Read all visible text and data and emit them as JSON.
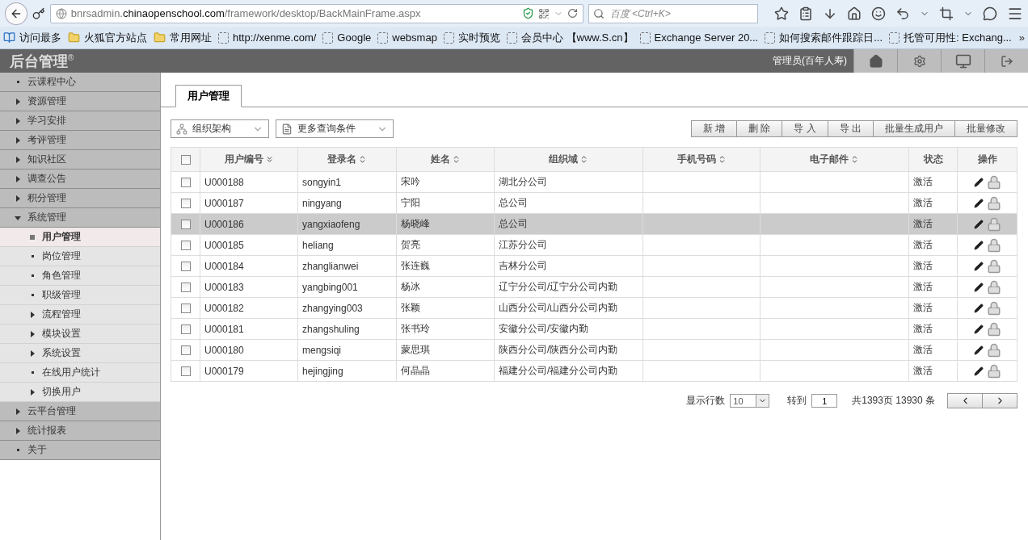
{
  "browser": {
    "url_prefix": "bnrsadmin.",
    "url_domain": "chinaopenschool.com",
    "url_path": "/framework/desktop/BackMainFrame.aspx",
    "search_placeholder": "百度 <Ctrl+K>",
    "bookmarks": [
      {
        "label": "访问最多",
        "kind": "smart"
      },
      {
        "label": "火狐官方站点",
        "kind": "folder"
      },
      {
        "label": "常用网址",
        "kind": "folder"
      },
      {
        "label": "http://xenme.com/",
        "kind": "page"
      },
      {
        "label": "Google",
        "kind": "page"
      },
      {
        "label": "websmap",
        "kind": "page"
      },
      {
        "label": "实时预览",
        "kind": "page"
      },
      {
        "label": "会员中心 【www.S.cn】",
        "kind": "page"
      },
      {
        "label": "Exchange Server 20...",
        "kind": "page"
      },
      {
        "label": "如何搜索邮件跟踪日...",
        "kind": "page"
      },
      {
        "label": "托管可用性: Exchang...",
        "kind": "page"
      }
    ],
    "overflow": "»"
  },
  "app": {
    "logo": "后台管理",
    "logo_mark": "®",
    "user": "管理员(百年人寿)"
  },
  "sidebar": {
    "items": [
      {
        "label": "云课程中心",
        "kind": "leaf"
      },
      {
        "label": "资源管理",
        "kind": "folder",
        "expanded": false
      },
      {
        "label": "学习安排",
        "kind": "folder",
        "expanded": false
      },
      {
        "label": "考评管理",
        "kind": "folder",
        "expanded": false
      },
      {
        "label": "知识社区",
        "kind": "folder",
        "expanded": false
      },
      {
        "label": "调查公告",
        "kind": "folder",
        "expanded": false
      },
      {
        "label": "积分管理",
        "kind": "folder",
        "expanded": false
      },
      {
        "label": "系统管理",
        "kind": "folder",
        "expanded": true,
        "children": [
          {
            "label": "用户管理",
            "kind": "leaf",
            "selected": true
          },
          {
            "label": "岗位管理",
            "kind": "leaf",
            "selected": false
          },
          {
            "label": "角色管理",
            "kind": "leaf",
            "selected": false
          },
          {
            "label": "职级管理",
            "kind": "leaf",
            "selected": false
          },
          {
            "label": "流程管理",
            "kind": "folder",
            "expanded": false,
            "selected": false
          },
          {
            "label": "模块设置",
            "kind": "folder",
            "expanded": false,
            "selected": false
          },
          {
            "label": "系统设置",
            "kind": "folder",
            "expanded": false,
            "selected": false
          },
          {
            "label": "在线用户统计",
            "kind": "leaf",
            "selected": false
          },
          {
            "label": "切换用户",
            "kind": "folder",
            "expanded": false,
            "selected": false
          }
        ]
      },
      {
        "label": "云平台管理",
        "kind": "folder",
        "expanded": false
      },
      {
        "label": "统计报表",
        "kind": "folder",
        "expanded": false
      },
      {
        "label": "关于",
        "kind": "leaf"
      }
    ]
  },
  "tabs": [
    {
      "label": "用户管理",
      "selected": true
    }
  ],
  "filters": [
    {
      "label": "组织架构",
      "kind": "tree"
    },
    {
      "label": "更多查询条件",
      "kind": "list"
    }
  ],
  "actions": [
    "新 增",
    "删 除",
    "导 入",
    "导 出",
    "批量生成用户",
    "批量修改"
  ],
  "table": {
    "all_checked": false,
    "columns": [
      {
        "label": "用户编号",
        "kind": "sorted"
      },
      {
        "label": "登录名",
        "kind": "sortable"
      },
      {
        "label": "姓名",
        "kind": "sortable"
      },
      {
        "label": "组织域",
        "kind": "sortable"
      },
      {
        "label": "手机号码",
        "kind": "sortable"
      },
      {
        "label": "电子邮件",
        "kind": "sortable"
      },
      {
        "label": "状态",
        "kind": "plain"
      },
      {
        "label": "操作",
        "kind": "plain"
      }
    ],
    "rows": [
      {
        "id": "U000188",
        "login": "songyin1",
        "name": "宋吟",
        "org": "湖北分公司",
        "status": "激活",
        "checked": false,
        "selected": false
      },
      {
        "id": "U000187",
        "login": "ningyang",
        "name": "宁阳",
        "org": "总公司",
        "status": "激活",
        "checked": false,
        "selected": false
      },
      {
        "id": "U000186",
        "login": "yangxiaofeng",
        "name": "杨晓峰",
        "org": "总公司",
        "status": "激活",
        "checked": false,
        "selected": true
      },
      {
        "id": "U000185",
        "login": "heliang",
        "name": "贺亮",
        "org": "江苏分公司",
        "status": "激活",
        "checked": false,
        "selected": false
      },
      {
        "id": "U000184",
        "login": "zhanglianwei",
        "name": "张连巍",
        "org": "吉林分公司",
        "status": "激活",
        "checked": false,
        "selected": false
      },
      {
        "id": "U000183",
        "login": "yangbing001",
        "name": "杨冰",
        "org": "辽宁分公司/辽宁分公司内勤",
        "status": "激活",
        "checked": false,
        "selected": false
      },
      {
        "id": "U000182",
        "login": "zhangying003",
        "name": "张颖",
        "org": "山西分公司/山西分公司内勤",
        "status": "激活",
        "checked": false,
        "selected": false
      },
      {
        "id": "U000181",
        "login": "zhangshuling",
        "name": "张书玲",
        "org": "安徽分公司/安徽内勤",
        "status": "激活",
        "checked": false,
        "selected": false
      },
      {
        "id": "U000180",
        "login": "mengsiqi",
        "name": "蒙思琪",
        "org": "陕西分公司/陕西分公司内勤",
        "status": "激活",
        "checked": false,
        "selected": false
      },
      {
        "id": "U000179",
        "login": "hejingjing",
        "name": "何晶晶",
        "org": "福建分公司/福建分公司内勤",
        "status": "激活",
        "checked": false,
        "selected": false
      }
    ]
  },
  "pagination": {
    "rows_label": "显示行数",
    "rows_value": "10",
    "goto_label": "转到",
    "page_value": "1",
    "total": "共1393页 13930 条"
  }
}
